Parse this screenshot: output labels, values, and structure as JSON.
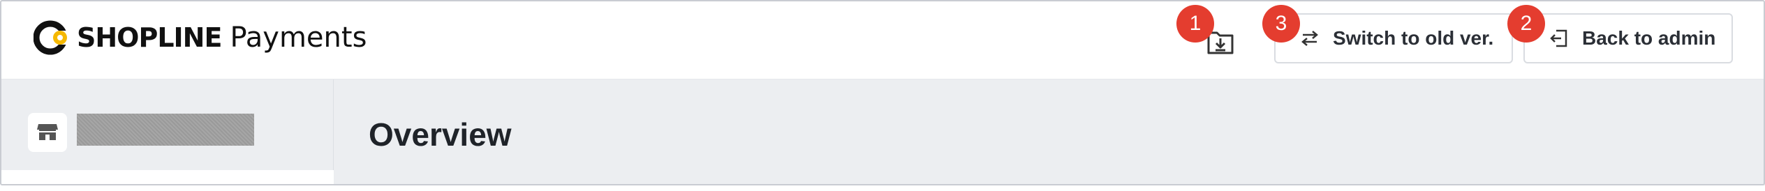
{
  "brand": {
    "name": "SHOPLINE",
    "product": "Payments"
  },
  "header": {
    "download_icon": "download-folder-icon",
    "switch_button_label": "Switch to old ver.",
    "switch_icon": "swap-arrows-icon",
    "back_button_label": "Back to admin",
    "back_icon": "exit-to-left-icon"
  },
  "annotations": [
    {
      "label": "1",
      "target": "download"
    },
    {
      "label": "3",
      "target": "switch"
    },
    {
      "label": "2",
      "target": "back"
    }
  ],
  "sidebar": {
    "store_icon": "store-icon",
    "store_name": ""
  },
  "main": {
    "title": "Overview"
  },
  "colors": {
    "badge": "#e43d2f",
    "background": "#eceef1",
    "text": "#1f2329",
    "logo_accent": "#f5b800"
  }
}
